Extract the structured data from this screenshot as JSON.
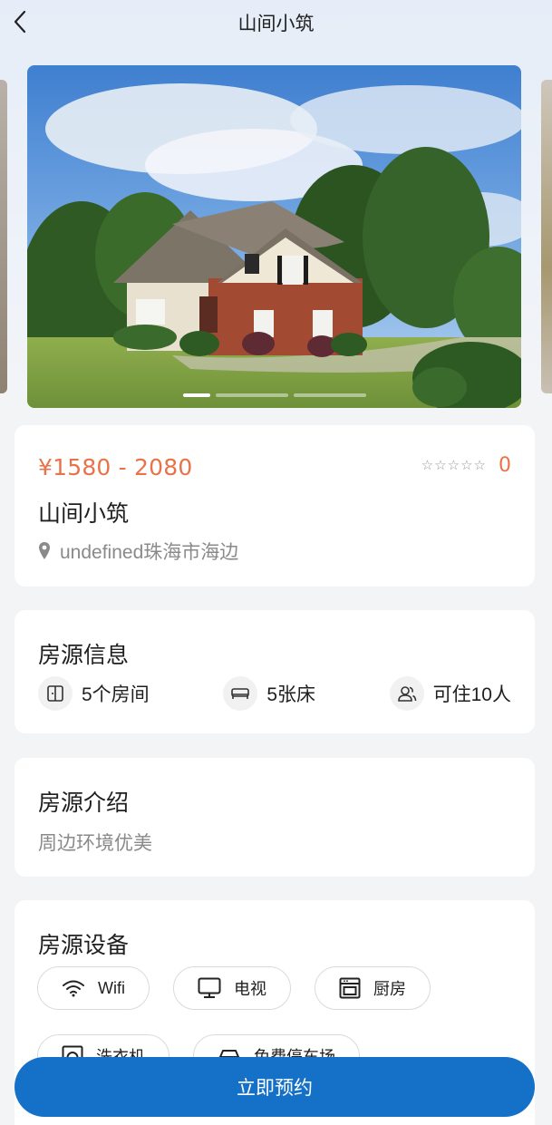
{
  "nav": {
    "title": "山间小筑"
  },
  "carousel": {
    "slide_count": 3,
    "active_index": 0
  },
  "detail": {
    "price": "¥1580 - 2080",
    "rating_count": "0",
    "star_rating": 0,
    "name": "山间小筑",
    "address": "undefined珠海市海边"
  },
  "house_info": {
    "title": "房源信息",
    "items": [
      {
        "icon": "door-icon",
        "label": "5个房间"
      },
      {
        "icon": "bed-icon",
        "label": "5张床"
      },
      {
        "icon": "people-icon",
        "label": "可住10人"
      }
    ]
  },
  "intro": {
    "title": "房源介绍",
    "text": "周边环境优美"
  },
  "facilities": {
    "title": "房源设备",
    "items": [
      {
        "icon": "wifi-icon",
        "label": "Wifi"
      },
      {
        "icon": "tv-icon",
        "label": "电视"
      },
      {
        "icon": "kitchen-icon",
        "label": "厨房"
      },
      {
        "icon": "washer-icon",
        "label": "洗衣机"
      },
      {
        "icon": "parking-icon",
        "label": "免费停车场"
      }
    ]
  },
  "actions": {
    "book_label": "立即预约"
  },
  "colors": {
    "accent": "#e8734a",
    "primary": "#1570c8"
  }
}
